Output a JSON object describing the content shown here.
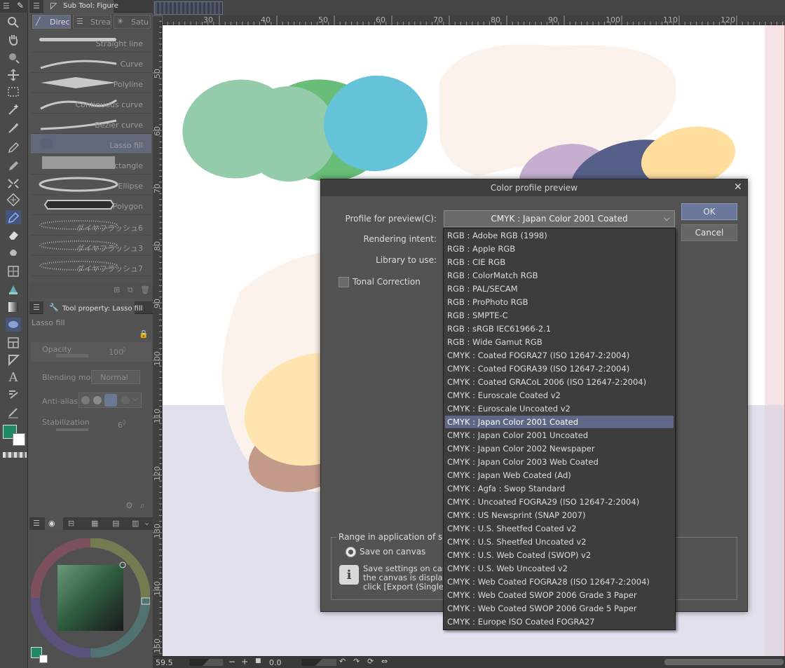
{
  "subtool": {
    "title": "Sub Tool: Figure",
    "tabs": [
      "Direc",
      "Strea",
      "Satu"
    ],
    "items": [
      "Straight line",
      "Curve",
      "Polyline",
      "Continuous curve",
      "Bezier curve",
      "Lasso fill",
      "Rectangle",
      "Ellipse",
      "Polygon",
      "ダイヤフラッシュ6",
      "ダイヤフラッシュ3",
      "ダイヤフラッシュ7"
    ],
    "selected": "Lasso fill"
  },
  "toolprop": {
    "title": "Tool property: Lasso fill",
    "name": "Lasso fill",
    "opacity_label": "Opacity",
    "opacity_value": "100",
    "blending_label": "Blending mode",
    "blending_value": "Normal",
    "antialias_label": "Anti-aliasing",
    "stabilization_label": "Stabilization",
    "stabilization_value": "6"
  },
  "ruler": {
    "top": [
      "30",
      "40",
      "50",
      "60",
      "70",
      "80",
      "90",
      "100",
      "110",
      "120"
    ],
    "left": [
      "50",
      "60",
      "70",
      "80",
      "90",
      "100",
      "110",
      "120",
      "130",
      "140",
      "150"
    ]
  },
  "status": {
    "zoom": "59.5",
    "angle": "0.0"
  },
  "dialog": {
    "title": "Color profile preview",
    "profile_label": "Profile for preview(C):",
    "profile_value": "CMYK : Japan Color 2001 Coated",
    "rendering_label": "Rendering intent:",
    "library_label": "Library to use:",
    "tonal_label": "Tonal Correction",
    "ok_label": "OK",
    "cancel_label": "Cancel",
    "range_label": "Range in application of settings",
    "save_on_canvas": "Save on canvas",
    "info_line1": "Save settings on canvas",
    "info_line2": "the canvas is displayed.",
    "info_line3": "click [Export (Single Lay"
  },
  "profiles": [
    "RGB : Adobe RGB (1998)",
    "RGB : Apple RGB",
    "RGB : CIE RGB",
    "RGB : ColorMatch RGB",
    "RGB : PAL/SECAM",
    "RGB : ProPhoto RGB",
    "RGB : SMPTE-C",
    "RGB : sRGB IEC61966-2.1",
    "RGB : Wide Gamut RGB",
    "CMYK : Coated FOGRA27 (ISO 12647-2:2004)",
    "CMYK : Coated FOGRA39 (ISO 12647-2:2004)",
    "CMYK : Coated GRACoL 2006 (ISO 12647-2:2004)",
    "CMYK : Euroscale Coated v2",
    "CMYK : Euroscale Uncoated v2",
    "CMYK : Japan Color 2001 Coated",
    "CMYK : Japan Color 2001 Uncoated",
    "CMYK : Japan Color 2002 Newspaper",
    "CMYK : Japan Color 2003 Web Coated",
    "CMYK : Japan Web Coated (Ad)",
    "CMYK : Agfa : Swop Standard",
    "CMYK : Uncoated FOGRA29 (ISO 12647-2:2004)",
    "CMYK : US Newsprint (SNAP 2007)",
    "CMYK : U.S. Sheetfed Coated v2",
    "CMYK : U.S. Sheetfed Uncoated v2",
    "CMYK : U.S. Web Coated (SWOP) v2",
    "CMYK : U.S. Web Uncoated v2",
    "CMYK : Web Coated FOGRA28 (ISO 12647-2:2004)",
    "CMYK : Web Coated SWOP 2006 Grade 3 Paper",
    "CMYK : Web Coated SWOP 2006 Grade 5 Paper",
    "CMYK : Europe ISO Coated FOGRA27"
  ],
  "selected_profile": "CMYK : Japan Color 2001 Coated",
  "colors": {
    "main_color": "#1f8a63",
    "selection": "#5e6785",
    "ok_button": "#6b779b",
    "canvas_bottom": "#e1e1ee"
  },
  "icons": [
    "menu-icon",
    "pen-icon",
    "zoom-icon",
    "hand-icon",
    "rotate-icon",
    "move-icon",
    "selection-icon",
    "magic-wand-icon",
    "eyedropper-icon",
    "pen-tool-icon",
    "pencil-icon",
    "airbrush-icon",
    "decoration-icon",
    "figure-icon",
    "eraser-icon",
    "fill-icon",
    "gradient-icon",
    "frame-icon",
    "ruler-icon",
    "text-icon",
    "balloon-icon",
    "correction-icon",
    "info-icon",
    "close-icon"
  ]
}
